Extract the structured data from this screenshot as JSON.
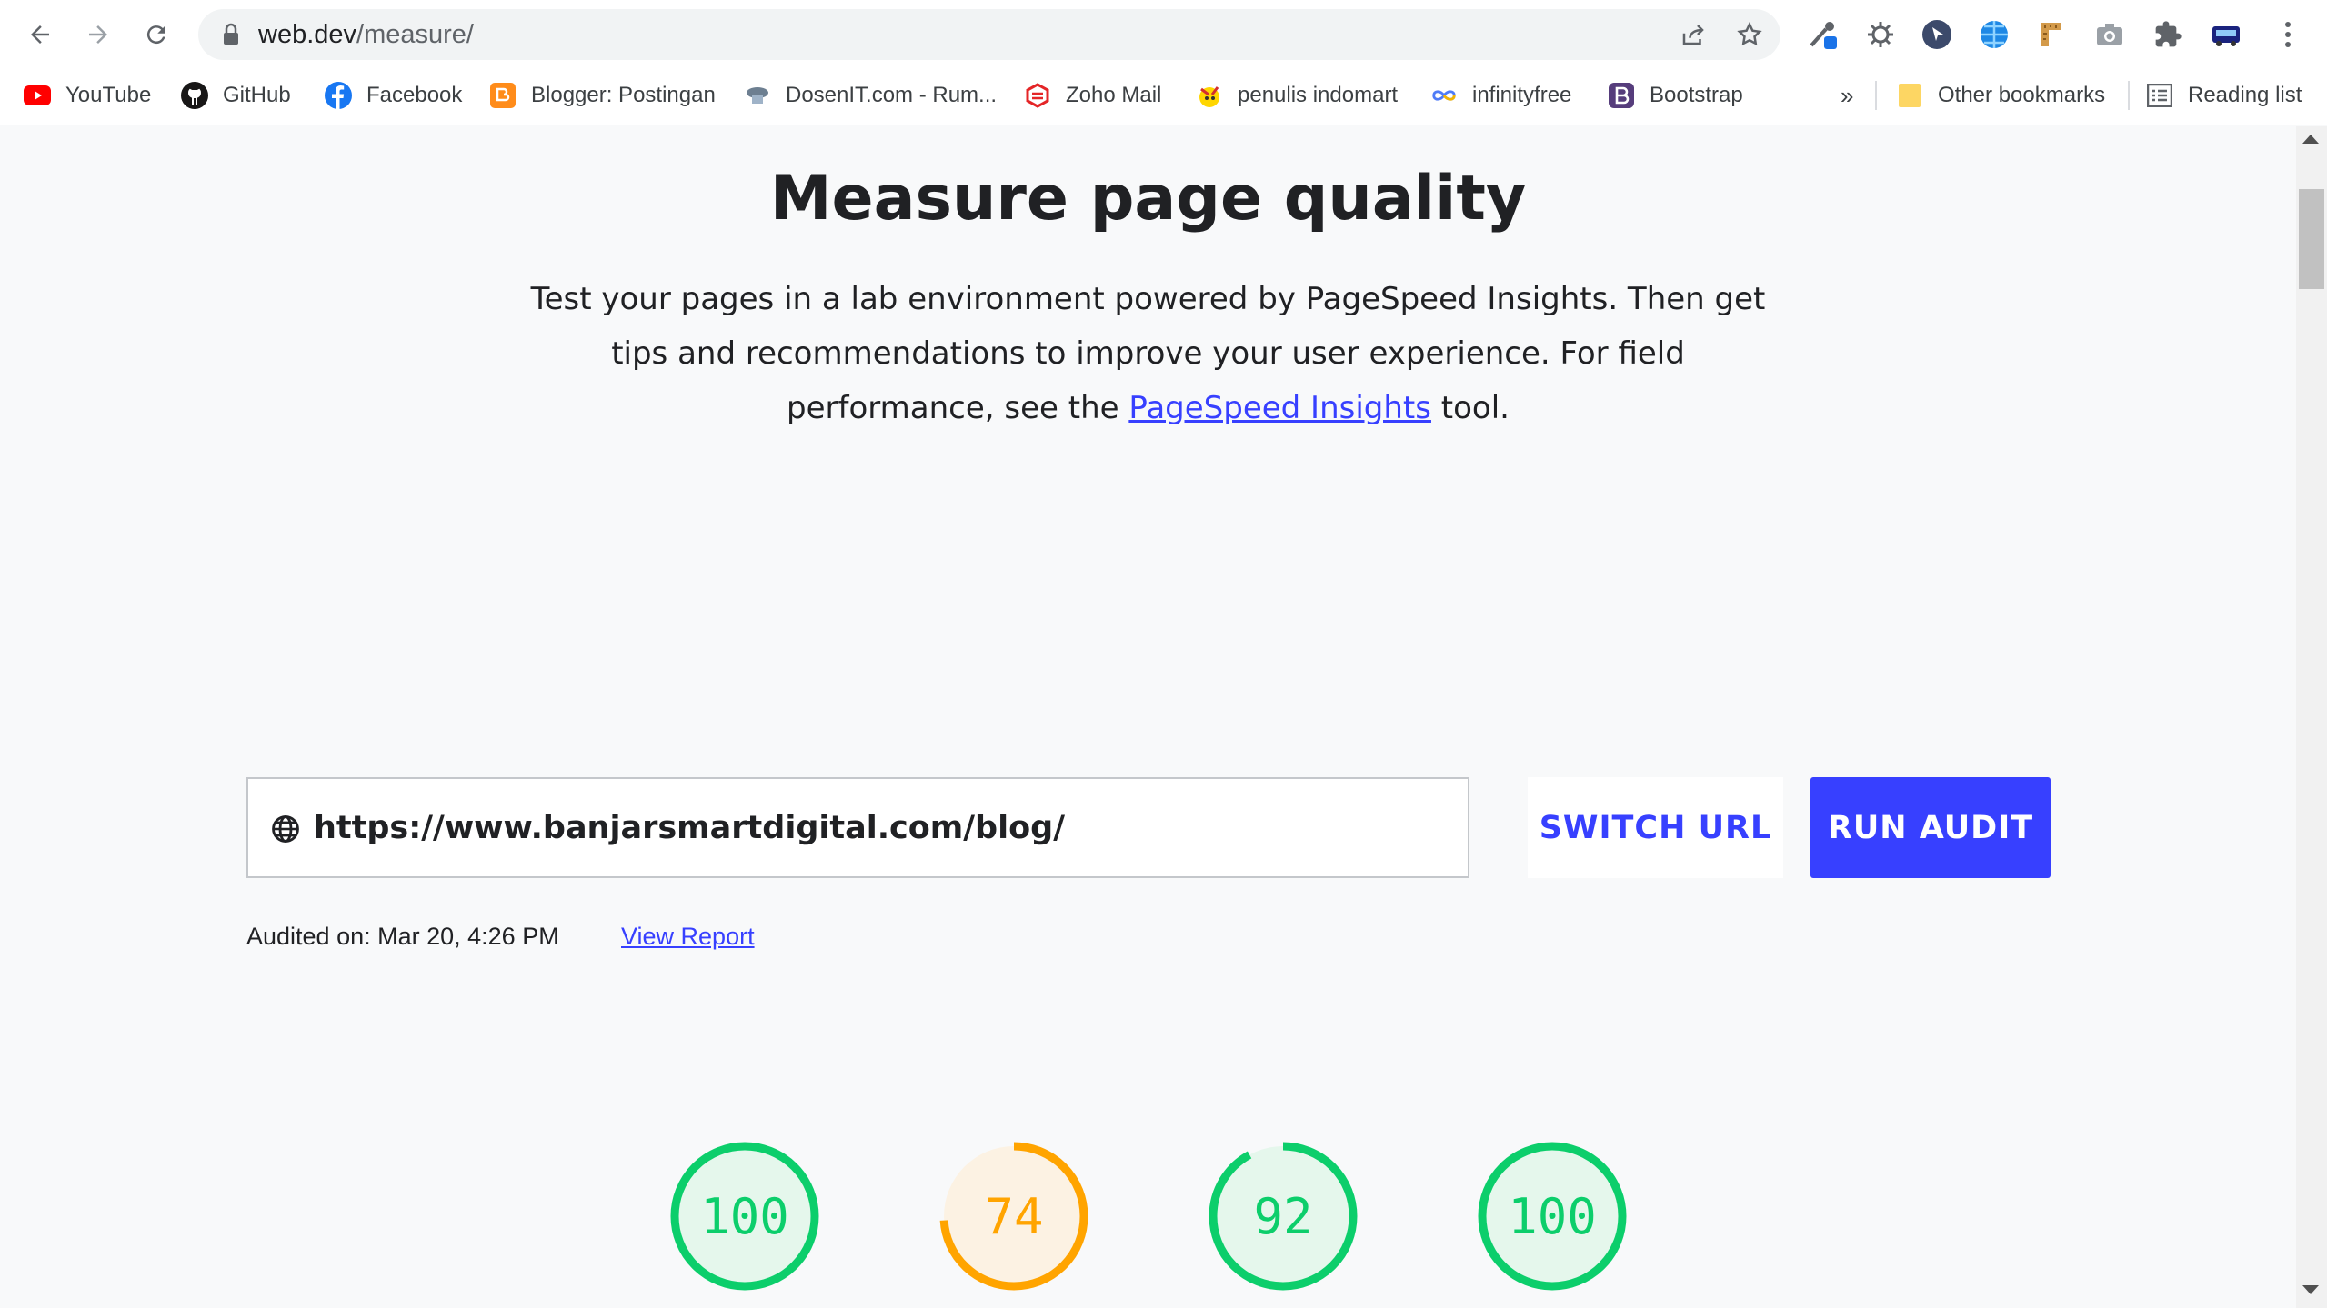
{
  "browser": {
    "url_host": "web.dev",
    "url_path": "/measure/",
    "bookmarks": [
      {
        "label": "YouTube",
        "icon": "youtube-icon"
      },
      {
        "label": "GitHub",
        "icon": "github-icon"
      },
      {
        "label": "Facebook",
        "icon": "facebook-icon"
      },
      {
        "label": "Blogger: Postingan",
        "icon": "blogger-icon"
      },
      {
        "label": "DosenIT.com - Rum...",
        "icon": "dosenit-icon"
      },
      {
        "label": "Zoho Mail",
        "icon": "zoho-icon"
      },
      {
        "label": "penulis indomart",
        "icon": "indomart-icon"
      },
      {
        "label": "infinityfree",
        "icon": "infinity-icon"
      },
      {
        "label": "Bootstrap",
        "icon": "bootstrap-icon"
      }
    ],
    "more_bookmarks": "»",
    "other_bookmarks": "Other bookmarks",
    "reading_list": "Reading list"
  },
  "page": {
    "title": "Measure page quality",
    "description_before": "Test your pages in a lab environment powered by PageSpeed Insights. Then get tips and recommendations to improve your user experience. For field performance, see the ",
    "description_link": "PageSpeed Insights",
    "description_after": " tool.",
    "url_input_value": "https://www.banjarsmartdigital.com/blog/",
    "switch_url_label": "SWITCH URL",
    "run_audit_label": "RUN AUDIT",
    "audited_on": "Audited on: Mar 20, 4:26 PM",
    "view_report": "View Report"
  },
  "scores": [
    {
      "value": 100,
      "label": "100",
      "color": "#0cce6b",
      "bg": "#e5f7ec"
    },
    {
      "value": 74,
      "label": "74",
      "color": "#ffa400",
      "bg": "#fcf2e3"
    },
    {
      "value": 92,
      "label": "92",
      "color": "#0cce6b",
      "bg": "#e5f7ec"
    },
    {
      "value": 100,
      "label": "100",
      "color": "#0cce6b",
      "bg": "#e5f7ec"
    }
  ],
  "colors": {
    "accent": "#3740ff",
    "pass": "#0cce6b",
    "average": "#ffa400"
  }
}
